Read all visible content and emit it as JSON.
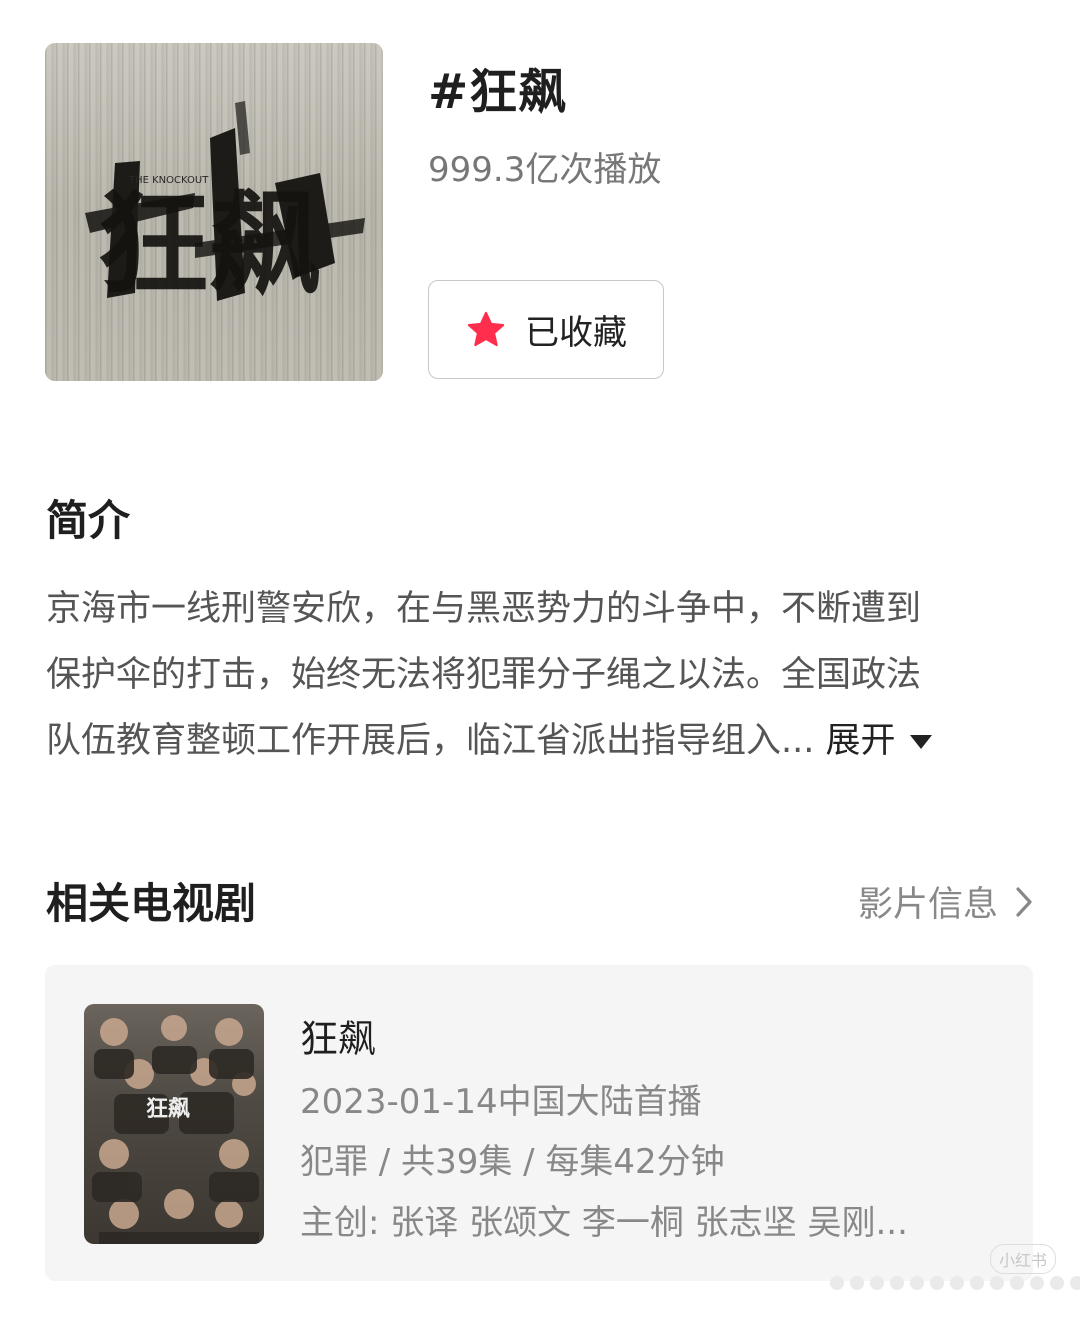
{
  "header": {
    "title": "#狂飙",
    "plays": "999.3亿次播放",
    "cover_text": "狂飙",
    "cover_subtitle": "THE KNOCKOUT",
    "collect_label": "已收藏",
    "collect_icon": "star-icon",
    "collect_color": "#ff2e4d"
  },
  "intro": {
    "title": "简介",
    "lines": [
      "京海市一线刑警安欣，在与黑恶势力的斗争中，不断遭到",
      "保护伞的打击，始终无法将犯罪分子绳之以法。全国政法",
      "队伍教育整顿工作开展后，临江省派出指导组入... "
    ],
    "expand_label": "展开",
    "expand_icon": "triangle-down-icon"
  },
  "related": {
    "title": "相关电视剧",
    "info_link": "影片信息",
    "info_icon": "chevron-right-icon",
    "card": {
      "poster_text": "狂飙",
      "name": "狂飙",
      "premiere": "2023-01-14中国大陆首播",
      "meta": "犯罪 / 共39集 / 每集42分钟",
      "creators": "主创: 张译 张颂文 李一桐 张志坚 吴刚..."
    }
  },
  "watermark": "小红书"
}
